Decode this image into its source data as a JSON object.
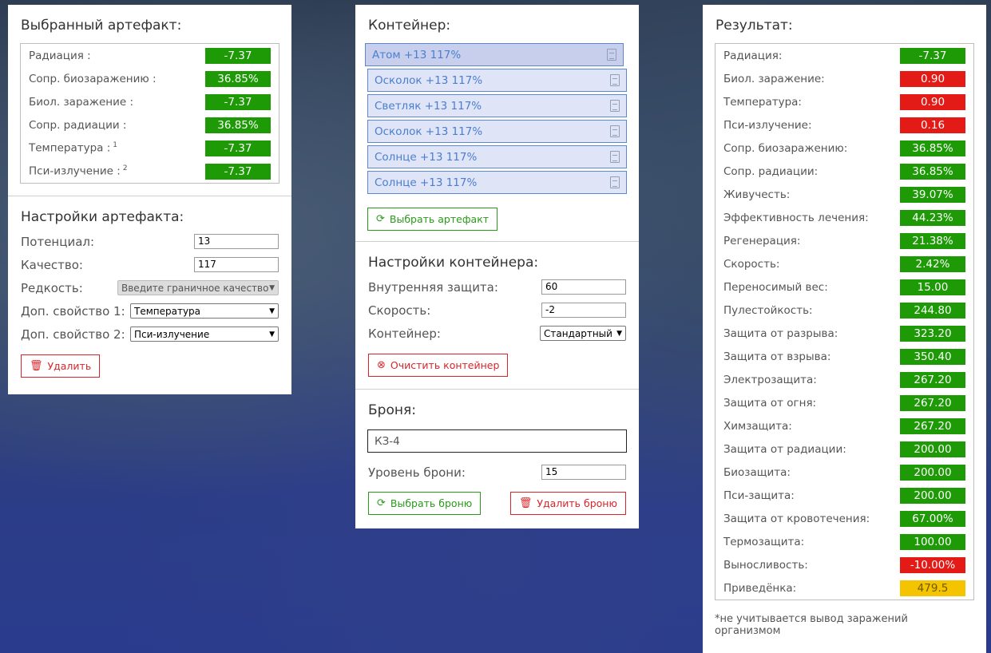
{
  "artifact": {
    "title": "Выбранный артефакт:",
    "stats": [
      {
        "label": "Радиация :",
        "sup": "",
        "value": "-7.37",
        "color": "green"
      },
      {
        "label": "Сопр. биозаражению :",
        "sup": "",
        "value": "36.85%",
        "color": "green"
      },
      {
        "label": "Биол. заражение :",
        "sup": "",
        "value": "-7.37",
        "color": "green"
      },
      {
        "label": "Сопр. радиации :",
        "sup": "",
        "value": "36.85%",
        "color": "green"
      },
      {
        "label": "Температура :",
        "sup": "1",
        "value": "-7.37",
        "color": "green"
      },
      {
        "label": "Пси-излучение :",
        "sup": "2",
        "value": "-7.37",
        "color": "green"
      }
    ],
    "settings_title": "Настройки артефакта:",
    "potential_label": "Потенциал:",
    "potential_value": "13",
    "quality_label": "Качество:",
    "quality_value": "117",
    "rarity_label": "Редкость:",
    "rarity_value": "Введите граничное качество",
    "extra1_label": "Доп. свойство 1:",
    "extra1_value": "Температура",
    "extra2_label": "Доп. свойство 2:",
    "extra2_value": "Пси-излучение",
    "delete_label": "Удалить"
  },
  "container": {
    "title": "Контейнер:",
    "items": [
      {
        "label": "Атом +13 117%",
        "selected": true
      },
      {
        "label": "Осколок +13 117%",
        "selected": false
      },
      {
        "label": "Светляк +13 117%",
        "selected": false
      },
      {
        "label": "Осколок +13 117%",
        "selected": false
      },
      {
        "label": "Солнце +13 117%",
        "selected": false
      },
      {
        "label": "Солнце +13 117%",
        "selected": false
      }
    ],
    "select_artifact_label": "Выбрать артефакт",
    "settings_title": "Настройки контейнера:",
    "protection_label": "Внутренняя защита:",
    "protection_value": "60",
    "speed_label": "Скорость:",
    "speed_value": "-2",
    "container_label": "Контейнер:",
    "container_value": "Стандартный",
    "clear_label": "Очистить контейнер"
  },
  "armor": {
    "title": "Броня:",
    "name": "КЗ-4",
    "level_label": "Уровень брони:",
    "level_value": "15",
    "select_label": "Выбрать броню",
    "delete_label": "Удалить броню"
  },
  "result": {
    "title": "Результат:",
    "stats": [
      {
        "label": "Радиация:",
        "value": "-7.37",
        "color": "green"
      },
      {
        "label": "Биол. заражение:",
        "value": "0.90",
        "color": "red"
      },
      {
        "label": "Температура:",
        "value": "0.90",
        "color": "red"
      },
      {
        "label": "Пси-излучение:",
        "value": "0.16",
        "color": "red"
      },
      {
        "label": "Сопр. биозаражению:",
        "value": "36.85%",
        "color": "green"
      },
      {
        "label": "Сопр. радиации:",
        "value": "36.85%",
        "color": "green"
      },
      {
        "label": "Живучесть:",
        "value": "39.07%",
        "color": "green"
      },
      {
        "label": "Эффективность лечения:",
        "value": "44.23%",
        "color": "green"
      },
      {
        "label": "Регенерация:",
        "value": "21.38%",
        "color": "green"
      },
      {
        "label": "Скорость:",
        "value": "2.42%",
        "color": "green"
      },
      {
        "label": "Переносимый вес:",
        "value": "15.00",
        "color": "green"
      },
      {
        "label": "Пулестойкость:",
        "value": "244.80",
        "color": "green"
      },
      {
        "label": "Защита от разрыва:",
        "value": "323.20",
        "color": "green"
      },
      {
        "label": "Защита от взрыва:",
        "value": "350.40",
        "color": "green"
      },
      {
        "label": "Электрозащита:",
        "value": "267.20",
        "color": "green"
      },
      {
        "label": "Защита от огня:",
        "value": "267.20",
        "color": "green"
      },
      {
        "label": "Химзащита:",
        "value": "267.20",
        "color": "green"
      },
      {
        "label": "Защита от радиации:",
        "value": "200.00",
        "color": "green"
      },
      {
        "label": "Биозащита:",
        "value": "200.00",
        "color": "green"
      },
      {
        "label": "Пси-защита:",
        "value": "200.00",
        "color": "green"
      },
      {
        "label": "Защита от кровотечения:",
        "value": "67.00%",
        "color": "green"
      },
      {
        "label": "Термозащита:",
        "value": "100.00",
        "color": "green"
      },
      {
        "label": "Выносливость:",
        "value": "-10.00%",
        "color": "red"
      },
      {
        "label": "Приведёнка:",
        "value": "479.5",
        "color": "yellow"
      }
    ],
    "note": "*не учитывается вывод заражений организмом"
  }
}
